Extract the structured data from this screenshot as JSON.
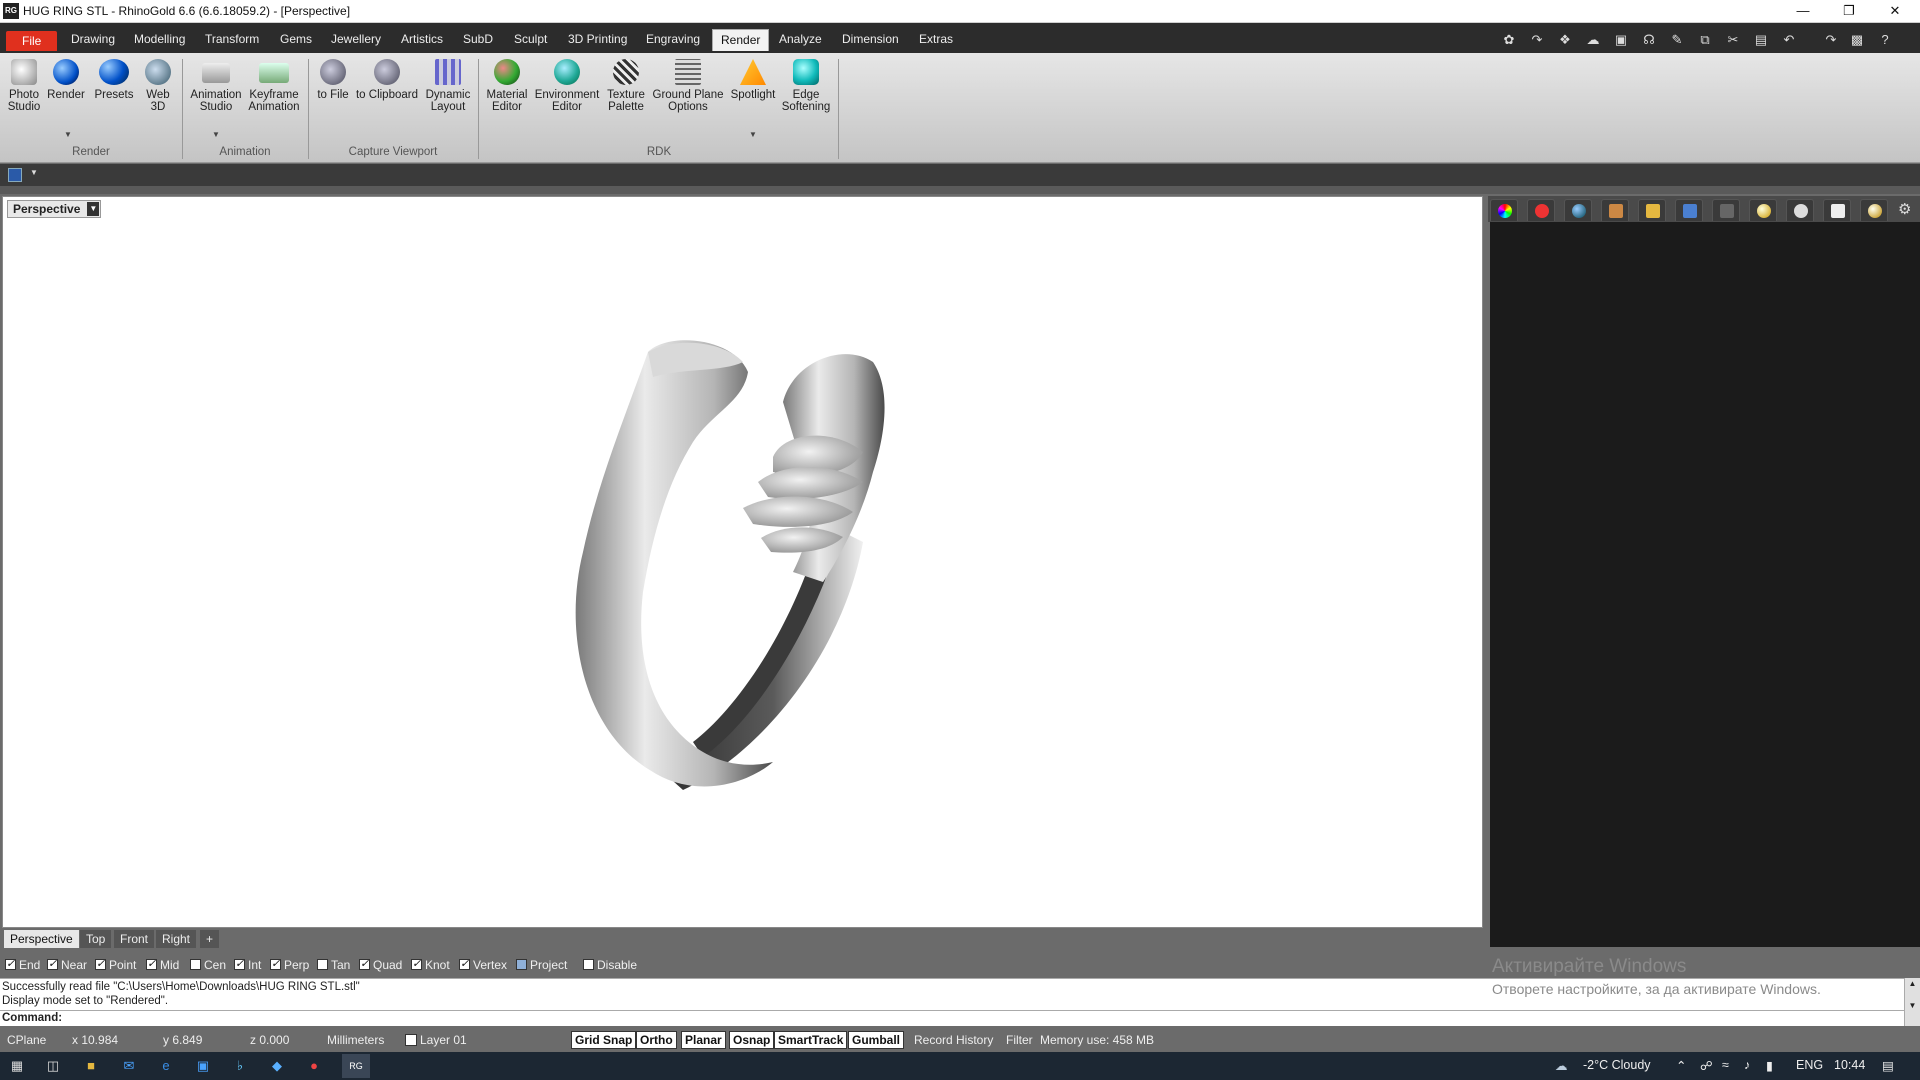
{
  "window": {
    "title": "HUG RING STL - RhinoGold 6.6 (6.6.18059.2) - [Perspective]",
    "icon_text": "RG"
  },
  "menu": {
    "items": [
      "File",
      "Drawing",
      "Modelling",
      "Transform",
      "Gems",
      "Jewellery",
      "Artistics",
      "SubD",
      "Sculpt",
      "3D Printing",
      "Engraving",
      "Render",
      "Analyze",
      "Dimension",
      "Extras"
    ],
    "active": "Render"
  },
  "ribbon": {
    "buttons": [
      {
        "line1": "Photo",
        "line2": "Studio",
        "icon": "photo-studio-icon"
      },
      {
        "line1": "Render",
        "line2": "",
        "icon": "render-sphere-icon"
      },
      {
        "line1": "Presets",
        "line2": "",
        "icon": "presets-icon"
      },
      {
        "line1": "Web",
        "line2": "3D",
        "icon": "web-3d-icon"
      },
      {
        "line1": "Animation",
        "line2": "Studio",
        "icon": "animation-studio-icon"
      },
      {
        "line1": "Keyframe",
        "line2": "Animation",
        "icon": "keyframe-animation-icon"
      },
      {
        "line1": "to File",
        "line2": "",
        "icon": "capture-to-file-icon"
      },
      {
        "line1": "to Clipboard",
        "line2": "",
        "icon": "capture-to-clipboard-icon"
      },
      {
        "line1": "Dynamic",
        "line2": "Layout",
        "icon": "dynamic-layout-icon"
      },
      {
        "line1": "Material",
        "line2": "Editor",
        "icon": "material-editor-icon"
      },
      {
        "line1": "Environment",
        "line2": "Editor",
        "icon": "environment-editor-icon"
      },
      {
        "line1": "Texture",
        "line2": "Palette",
        "icon": "texture-palette-icon"
      },
      {
        "line1": "Ground Plane",
        "line2": "Options",
        "icon": "ground-plane-icon"
      },
      {
        "line1": "Spotlight",
        "line2": "",
        "icon": "spotlight-icon"
      },
      {
        "line1": "Edge",
        "line2": "Softening",
        "icon": "edge-softening-icon"
      }
    ],
    "groups": [
      "Render",
      "Animation",
      "Capture Viewport",
      "RDK"
    ]
  },
  "viewport": {
    "label": "Perspective",
    "tabs": [
      "Perspective",
      "Top",
      "Front",
      "Right"
    ],
    "active_tab": "Perspective",
    "add_tab_symbol": "+"
  },
  "osnap": {
    "items": [
      {
        "label": "End",
        "checked": true
      },
      {
        "label": "Near",
        "checked": true
      },
      {
        "label": "Point",
        "checked": true
      },
      {
        "label": "Mid",
        "checked": true
      },
      {
        "label": "Cen",
        "checked": false
      },
      {
        "label": "Int",
        "checked": true
      },
      {
        "label": "Perp",
        "checked": true
      },
      {
        "label": "Tan",
        "checked": false
      },
      {
        "label": "Quad",
        "checked": true
      },
      {
        "label": "Knot",
        "checked": true
      },
      {
        "label": "Vertex",
        "checked": true
      },
      {
        "label": "Project",
        "checked": false
      },
      {
        "label": "Disable",
        "checked": false
      }
    ]
  },
  "history": {
    "line1": "Successfully read file \"C:\\Users\\Home\\Downloads\\HUG RING STL.stl\"",
    "line2": "Display mode set to \"Rendered\"."
  },
  "command": {
    "label": "Command:",
    "value": ""
  },
  "watermark": {
    "title": "Активирайте Windows",
    "subtitle": "Отворете настройките, за да активирате Windows."
  },
  "status": {
    "cplane": "CPlane",
    "x": "x 10.984",
    "y": "y 6.849",
    "z": "z 0.000",
    "units": "Millimeters",
    "layer": "Layer 01",
    "toggles": [
      "Grid Snap",
      "Ortho",
      "Planar",
      "Osnap",
      "SmartTrack",
      "Gumball"
    ],
    "record_history": "Record History",
    "filter": "Filter",
    "memory": "Memory use: 458 MB"
  },
  "taskbar": {
    "weather": "-2°C  Cloudy",
    "language": "ENG",
    "time": "10:44"
  },
  "colors": {
    "file_tab": "#e0301e",
    "menubar": "#2c2c2c",
    "panel_dark": "#1b1b1b",
    "taskbar": "#1c2733"
  }
}
